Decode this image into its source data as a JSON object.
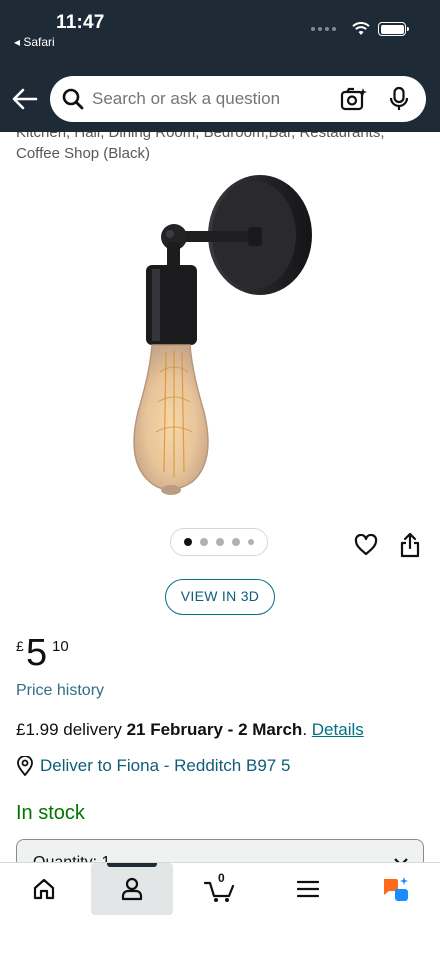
{
  "status_bar": {
    "time": "11:47",
    "back_app": "◂ Safari"
  },
  "header": {
    "search_placeholder": "Search or ask a question",
    "icons": [
      "back-arrow-icon",
      "search-icon",
      "camera-search-icon",
      "microphone-icon"
    ]
  },
  "product": {
    "title_fragment_1": "Kitchen, Hall, Dining Room, Bedroom,Bar, Restaurants,",
    "title_fragment_2": "Coffee Shop (Black)",
    "image_count": 5,
    "image_active_index": 0,
    "view_3d_label": "VIEW IN 3D",
    "price_currency": "£",
    "price_whole": "5",
    "price_fraction": "10",
    "price_history_label": "Price history",
    "delivery_prefix": "£1.99 delivery ",
    "delivery_dates": "21 February - 2 March",
    "delivery_suffix": ". ",
    "details_link": "Details",
    "deliver_to": "Deliver to Fiona - Redditch B97 5",
    "stock_status": "In stock",
    "quantity_label": "Quantity: 1"
  },
  "bottom_nav": {
    "items": [
      "home-icon",
      "account-icon",
      "cart-icon",
      "menu-icon",
      "rufus-icon"
    ],
    "active": "account-icon",
    "cart_count": "0"
  },
  "colors": {
    "header_bg": "#1e2a36",
    "link": "#007185",
    "in_stock": "#007600",
    "rufus_orange": "#ff6a1a",
    "rufus_blue": "#1a8cff"
  }
}
